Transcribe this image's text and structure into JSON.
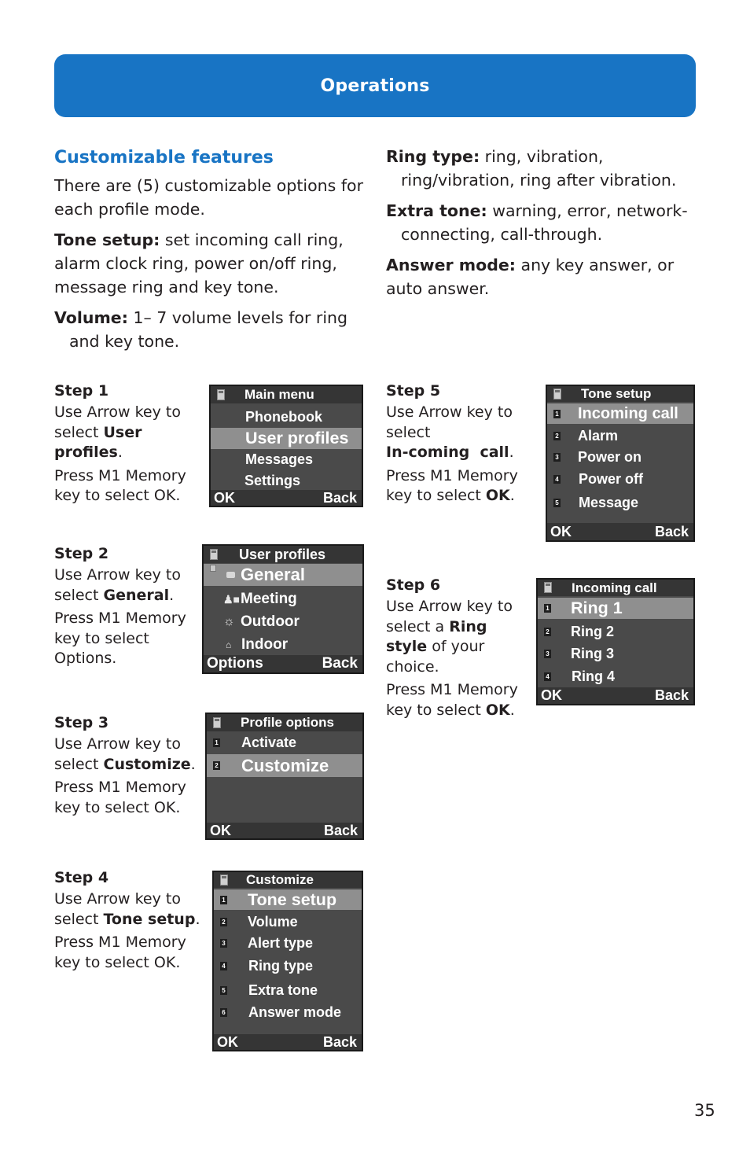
{
  "banner": {
    "title": "Operations"
  },
  "intro": {
    "section_title": "Customizable features",
    "lead": "There are (5) customizable options for each profile mode.",
    "features": [
      {
        "term": "Tone setup:",
        "desc": " set incoming call ring, alarm clock ring, power on/off ring, message ring and key tone."
      },
      {
        "term": "Volume:",
        "desc": " 1– 7 volume levels for ring and key tone."
      },
      {
        "term": "Ring type:",
        "desc": " ring, vibration, ring/vibration, ring after vibration."
      },
      {
        "term": "Extra tone:",
        "desc": " warning, error, network-connecting, call-through."
      },
      {
        "term": "Answer mode:",
        "desc": " any key answer, or auto answer."
      }
    ]
  },
  "steps": [
    {
      "title": "Step 1",
      "pre": "Use Arrow key to select ",
      "bold": "User profiles",
      "post": ".",
      "press_pre": "Press M1 Memory key to select ",
      "press_bold": "",
      "press_post": "OK."
    },
    {
      "title": "Step 2",
      "pre": "Use Arrow key to select ",
      "bold": "General",
      "post": ".",
      "press_pre": "Press M1 Memory key to select ",
      "press_bold": "",
      "press_post": "Options."
    },
    {
      "title": "Step 3",
      "pre": "Use Arrow key to select ",
      "bold": "Customize",
      "post": ".",
      "press_pre": "Press M1 Memory key to select ",
      "press_bold": "",
      "press_post": "OK."
    },
    {
      "title": "Step 4",
      "pre": "Use Arrow key to select ",
      "bold": "Tone setup",
      "post": ".",
      "press_pre": "Press M1 Memory key to select ",
      "press_bold": "",
      "press_post": "OK."
    },
    {
      "title": "Step 5",
      "pre": "Use Arrow key to select ",
      "bold": "In-coming  call",
      "post": ".",
      "press_pre": "Press M1 Memory key to select ",
      "press_bold": "OK",
      "press_post": "."
    },
    {
      "title": "Step 6",
      "pre": "Use Arrow key to select a ",
      "bold": "Ring style",
      "post": " of your choice.",
      "press_pre": "Press M1 Memory key to select ",
      "press_bold": "OK",
      "press_post": "."
    }
  ],
  "screens": {
    "main_menu": {
      "title": "Main menu",
      "items": [
        "Phonebook",
        "User profiles",
        "Messages",
        "Settings"
      ],
      "selected": "User profiles",
      "left_softkey": "OK",
      "right_softkey": "Back"
    },
    "user_profiles": {
      "title": "User profiles",
      "items": [
        {
          "label": "General",
          "icon": "general-profile-icon"
        },
        {
          "label": "Meeting",
          "icon": "meeting-profile-icon"
        },
        {
          "label": "Outdoor",
          "icon": "sun-icon"
        },
        {
          "label": "Indoor",
          "icon": "house-icon"
        }
      ],
      "selected": "General",
      "left_softkey": "Options",
      "right_softkey": "Back"
    },
    "profile_options": {
      "title": "Profile options",
      "items": [
        {
          "n": "1",
          "label": "Activate"
        },
        {
          "n": "2",
          "label": "Customize"
        }
      ],
      "selected": "Customize",
      "left_softkey": "OK",
      "right_softkey": "Back"
    },
    "customize": {
      "title": "Customize",
      "items": [
        {
          "n": "1",
          "label": "Tone setup"
        },
        {
          "n": "2",
          "label": "Volume"
        },
        {
          "n": "3",
          "label": "Alert type"
        },
        {
          "n": "4",
          "label": "Ring type"
        },
        {
          "n": "5",
          "label": "Extra tone"
        },
        {
          "n": "6",
          "label": "Answer mode"
        }
      ],
      "selected": "Tone setup",
      "left_softkey": "OK",
      "right_softkey": "Back"
    },
    "tone_setup": {
      "title": "Tone setup",
      "items": [
        {
          "n": "1",
          "label": "Incoming call"
        },
        {
          "n": "2",
          "label": "Alarm"
        },
        {
          "n": "3",
          "label": "Power on"
        },
        {
          "n": "4",
          "label": "Power off"
        },
        {
          "n": "5",
          "label": "Message"
        }
      ],
      "selected": "Incoming call",
      "left_softkey": "OK",
      "right_softkey": "Back"
    },
    "incoming_call": {
      "title": "Incoming call",
      "items": [
        {
          "n": "1",
          "label": "Ring 1"
        },
        {
          "n": "2",
          "label": "Ring 2"
        },
        {
          "n": "3",
          "label": "Ring 3"
        },
        {
          "n": "4",
          "label": "Ring 4"
        }
      ],
      "selected": "Ring 1",
      "left_softkey": "OK",
      "right_softkey": "Back"
    }
  },
  "page_number": "35"
}
